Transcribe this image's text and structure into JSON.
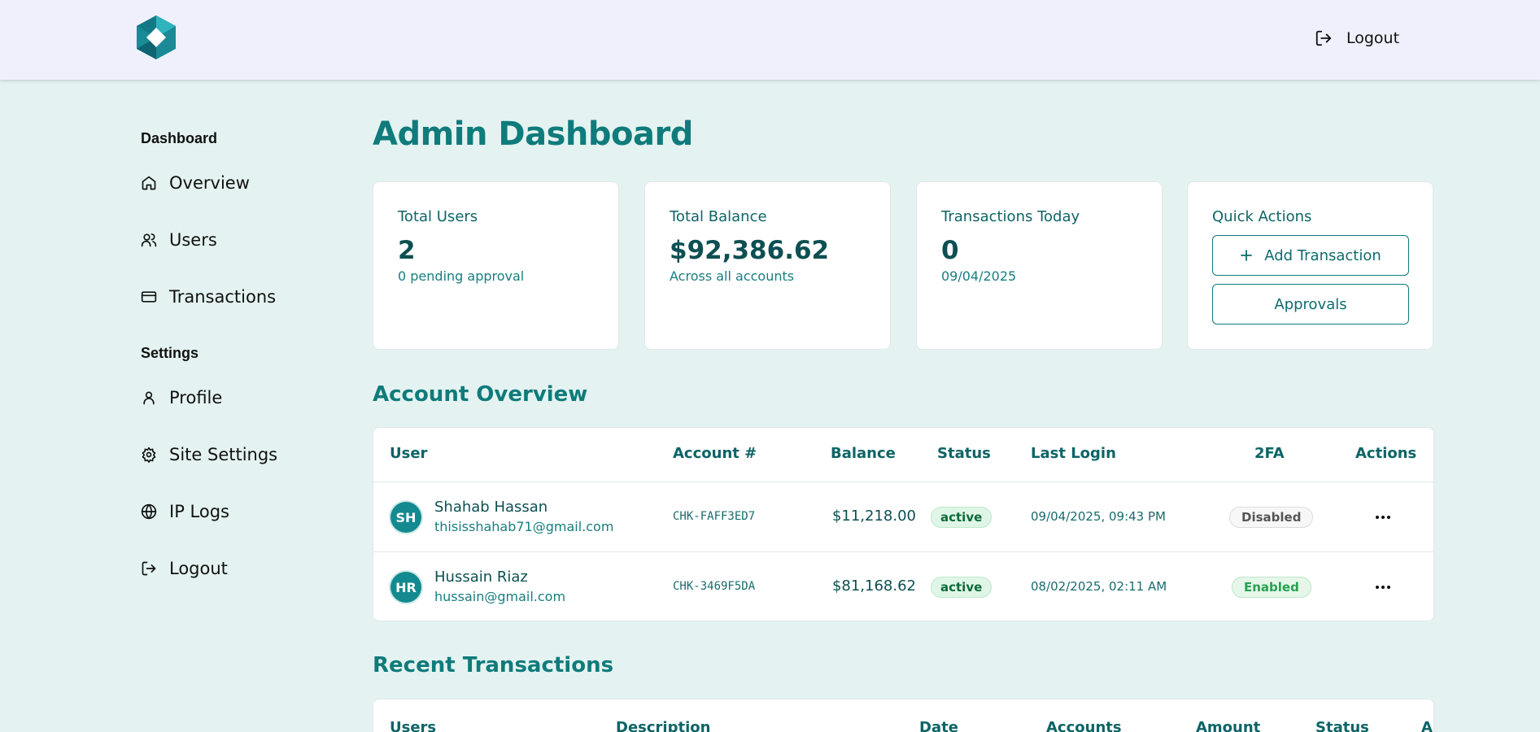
{
  "header": {
    "logout_label": "Logout"
  },
  "sidebar": {
    "sections": [
      {
        "title": "Dashboard",
        "items": [
          {
            "label": "Overview",
            "icon": "home-icon"
          },
          {
            "label": "Users",
            "icon": "users-icon"
          },
          {
            "label": "Transactions",
            "icon": "credit-card-icon"
          }
        ]
      },
      {
        "title": "Settings",
        "items": [
          {
            "label": "Profile",
            "icon": "user-icon"
          },
          {
            "label": "Site Settings",
            "icon": "gear-icon"
          },
          {
            "label": "IP Logs",
            "icon": "globe-icon"
          },
          {
            "label": "Logout",
            "icon": "logout-icon"
          }
        ]
      }
    ]
  },
  "main": {
    "title": "Admin Dashboard",
    "cards": {
      "total_users": {
        "label": "Total Users",
        "value": "2",
        "sub": "0 pending approval"
      },
      "total_balance": {
        "label": "Total Balance",
        "value": "$92,386.62",
        "sub": "Across all accounts"
      },
      "transactions_today": {
        "label": "Transactions Today",
        "value": "0",
        "sub": "09/04/2025"
      },
      "quick_actions": {
        "label": "Quick Actions",
        "add_transaction": "Add Transaction",
        "approvals": "Approvals"
      }
    },
    "account_overview": {
      "title": "Account Overview",
      "columns": [
        "User",
        "Account #",
        "Balance",
        "Status",
        "Last Login",
        "2FA",
        "Actions"
      ],
      "rows": [
        {
          "initials": "SH",
          "name": "Shahab Hassan",
          "email": "thisisshahab71@gmail.com",
          "account": "CHK-FAFF3ED7",
          "balance": "$11,218.00",
          "status": "active",
          "last_login": "09/04/2025, 09:43 PM",
          "twofa": "Disabled"
        },
        {
          "initials": "HR",
          "name": "Hussain Riaz",
          "email": "hussain@gmail.com",
          "account": "CHK-3469F5DA",
          "balance": "$81,168.62",
          "status": "active",
          "last_login": "08/02/2025, 02:11 AM",
          "twofa": "Enabled"
        }
      ]
    },
    "recent_transactions": {
      "title": "Recent Transactions",
      "columns": [
        "Users",
        "Description",
        "Date",
        "Accounts",
        "Amount",
        "Status",
        "A"
      ]
    }
  },
  "colors": {
    "accent": "#0f7b7b",
    "background": "#e4f3f1",
    "header": "#eff0fb"
  }
}
